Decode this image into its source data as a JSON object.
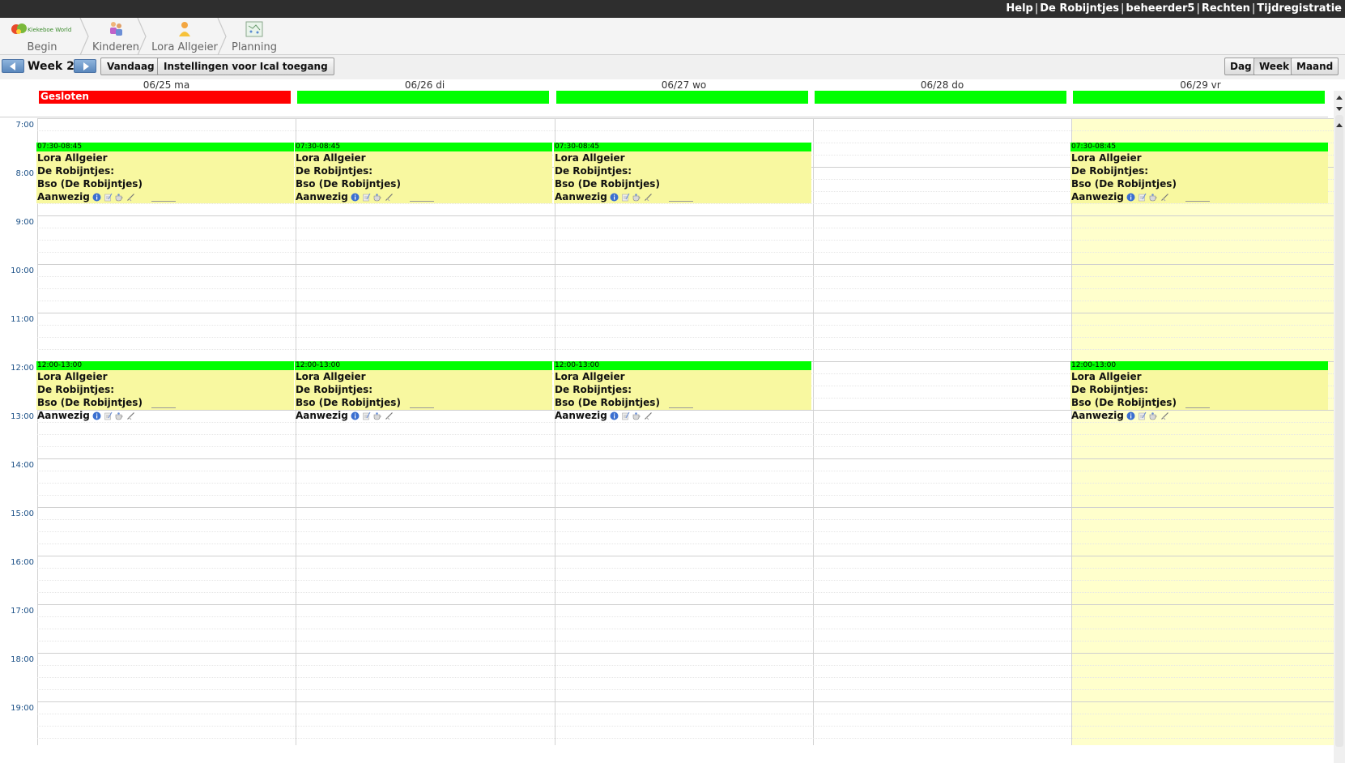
{
  "topbar": {
    "links": [
      "Help",
      "De Robijntjes",
      "beheerder5",
      "Rechten",
      "Tijdregistratie"
    ]
  },
  "breadcrumb": {
    "logo_text": "Kiekeboe World",
    "items": [
      {
        "label": "Begin",
        "icon": "home-logo-icon"
      },
      {
        "label": "Kinderen",
        "icon": "children-icon"
      },
      {
        "label": "Lora Allgeier",
        "icon": "person-icon"
      },
      {
        "label": "Planning",
        "icon": "planning-icon"
      }
    ]
  },
  "toolbar": {
    "week_label": "Week 26",
    "today_label": "Vandaag",
    "ical_label": "Instellingen voor Ical toegang",
    "views": [
      "Dag",
      "Week",
      "Maand"
    ],
    "active_view": "Week"
  },
  "calendar": {
    "days": [
      {
        "label": "06/25 ma",
        "allday": "Gesloten",
        "allday_color": "#ff0000",
        "today": false
      },
      {
        "label": "06/26 di",
        "allday": "",
        "allday_color": "#00ff00",
        "today": false
      },
      {
        "label": "06/27 wo",
        "allday": "",
        "allday_color": "#00ff00",
        "today": false
      },
      {
        "label": "06/28 do",
        "allday": "",
        "allday_color": "#00ff00",
        "today": false
      },
      {
        "label": "06/29 vr",
        "allday": "",
        "allday_color": "#00ff00",
        "today": true
      }
    ],
    "hours": [
      "7:00",
      "8:00",
      "9:00",
      "10:00",
      "11:00",
      "12:00",
      "13:00",
      "14:00",
      "15:00",
      "16:00",
      "17:00",
      "18:00",
      "19:00"
    ],
    "event_blocks": [
      {
        "time": "07:30-08:45",
        "name": "Lora Allgeier",
        "group": "De Robijntjes:",
        "location": "Bso (De Robijntjes)",
        "status": "Aanwezig",
        "days": [
          0,
          1,
          2,
          4
        ]
      },
      {
        "time": "12:00-13:00",
        "name": "Lora Allgeier",
        "group": "De Robijntjes:",
        "location": "Bso (De Robijntjes)",
        "status": "Aanwezig",
        "days": [
          0,
          1,
          2,
          4
        ]
      }
    ],
    "event_icons": [
      "info-icon",
      "note-icon",
      "teacup-icon",
      "edit-icon"
    ]
  },
  "colors": {
    "topbar": "#2e2e2e",
    "closed": "#ff0000",
    "open": "#00ff00",
    "event_bg": "#f8f8a0",
    "today_bg": "#ffffcc"
  }
}
